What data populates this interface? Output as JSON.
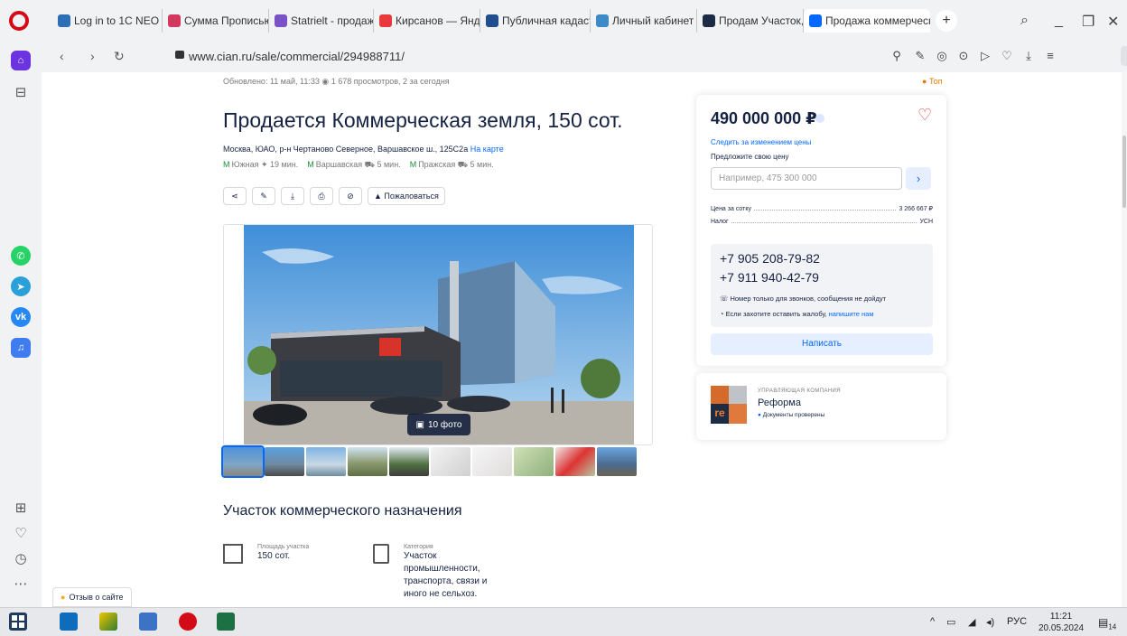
{
  "browser": {
    "tabs": [
      {
        "title": "Log in to 1C NEO",
        "color": "#2d6fb7"
      },
      {
        "title": "Сумма Прописью",
        "color": "#d2375e"
      },
      {
        "title": "Statrielt - продажа",
        "color": "#7a52c7"
      },
      {
        "title": "Кирсанов — Яндекс",
        "color": "#e8393d"
      },
      {
        "title": "Публичная кадастр",
        "color": "#1f4f8f"
      },
      {
        "title": "Личный кабинет",
        "color": "#3d8ac9"
      },
      {
        "title": "Продам Участок, г",
        "color": "#1d2b44"
      },
      {
        "title": "Продажа коммерческой",
        "color": "#0468ff",
        "active": true
      }
    ],
    "add_tab": "+",
    "url": "www.cian.ru/sale/commercial/294988711/"
  },
  "listing": {
    "updated": "Обновлено: 11 май, 11:33   ◉ 1 678 просмотров, 2 за сегодня",
    "badge": "Топ",
    "title": "Продается Коммерческая земля, 150 сот.",
    "address": "Москва, ЮАО, р-н Чертаново Северное, Варшавское ш., 125С2а",
    "map_link": "На карте",
    "metro": [
      {
        "station": "Южная",
        "time": "19 мин."
      },
      {
        "station": "Варшавская",
        "time": "5 мин."
      },
      {
        "station": "Пражская",
        "time": "5 мин."
      }
    ],
    "complain": "Пожаловаться",
    "photo_count": "10 фото",
    "section_title": "Участок коммерческого назначения",
    "area_label": "Площадь участка",
    "area_value": "150 сот.",
    "category_label": "Категория",
    "category_value": "Участок промышленности, транспорта, связи и иного не сельхоз.",
    "feedback": "Отзыв о сайте"
  },
  "card": {
    "price": "490 000 000 ₽",
    "track": "Следить за изменением цены",
    "offer_label": "Предложите свою цену",
    "offer_placeholder": "Например, 475 300 000",
    "per_sotka_label": "Цена за сотку",
    "per_sotka_value": "3 266 667 ₽",
    "tax_label": "Налог",
    "tax_value": "УСН",
    "phone1": "+7 905 208-79-82",
    "phone2": "+7 911 940-42-79",
    "note1": "Номер только для звонков, сообщения не дойдут",
    "note2": "Если захотите оставить жалобу,",
    "note2_link": "напишите нам",
    "write": "Написать"
  },
  "agency": {
    "kind": "УПРАВЛЯЮЩАЯ КОМПАНИЯ",
    "name": "Реформа",
    "verified": "Документы проверены",
    "logo_text": "re"
  },
  "taskbar": {
    "lang": "РУС",
    "time": "11:21",
    "date": "20.05.2024",
    "notifications": "14"
  }
}
